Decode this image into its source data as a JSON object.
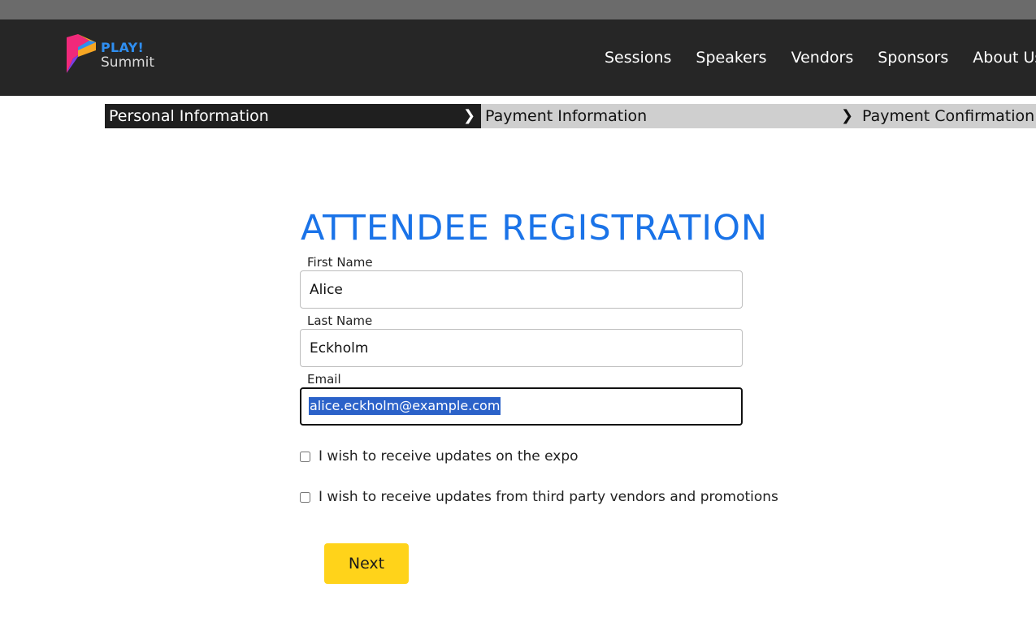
{
  "brand": {
    "line1": "PLAY!",
    "line2": "Summit",
    "logo_colors": [
      "#f0297a",
      "#f6a623",
      "#2f8ef0",
      "#7b3fe4"
    ]
  },
  "nav": {
    "items": [
      "Sessions",
      "Speakers",
      "Vendors",
      "Sponsors",
      "About Us"
    ]
  },
  "steps": {
    "items": [
      {
        "label": "Personal Information",
        "active": true
      },
      {
        "label": "Payment Information",
        "active": false
      },
      {
        "label": "Payment Confirmation",
        "active": false
      }
    ],
    "chevron_icon": "chevron-right-icon",
    "chevron_glyph": "❯"
  },
  "form": {
    "title": "ATTENDEE REGISTRATION",
    "first_name": {
      "label": "First Name",
      "value": "Alice"
    },
    "last_name": {
      "label": "Last Name",
      "value": "Eckholm"
    },
    "email": {
      "label": "Email",
      "value": "alice.eckholm@example.com",
      "selected": true,
      "focused": true
    },
    "checkboxes": [
      {
        "label": "I wish to receive updates on the expo",
        "checked": false
      },
      {
        "label": "I wish to receive updates from third party vendors and promotions",
        "checked": false
      }
    ],
    "next_label": "Next"
  },
  "colors": {
    "header_bg": "#262626",
    "title_blue": "#1a73e8",
    "button_yellow": "#ffd31a",
    "selection_blue": "#2b62c9"
  }
}
